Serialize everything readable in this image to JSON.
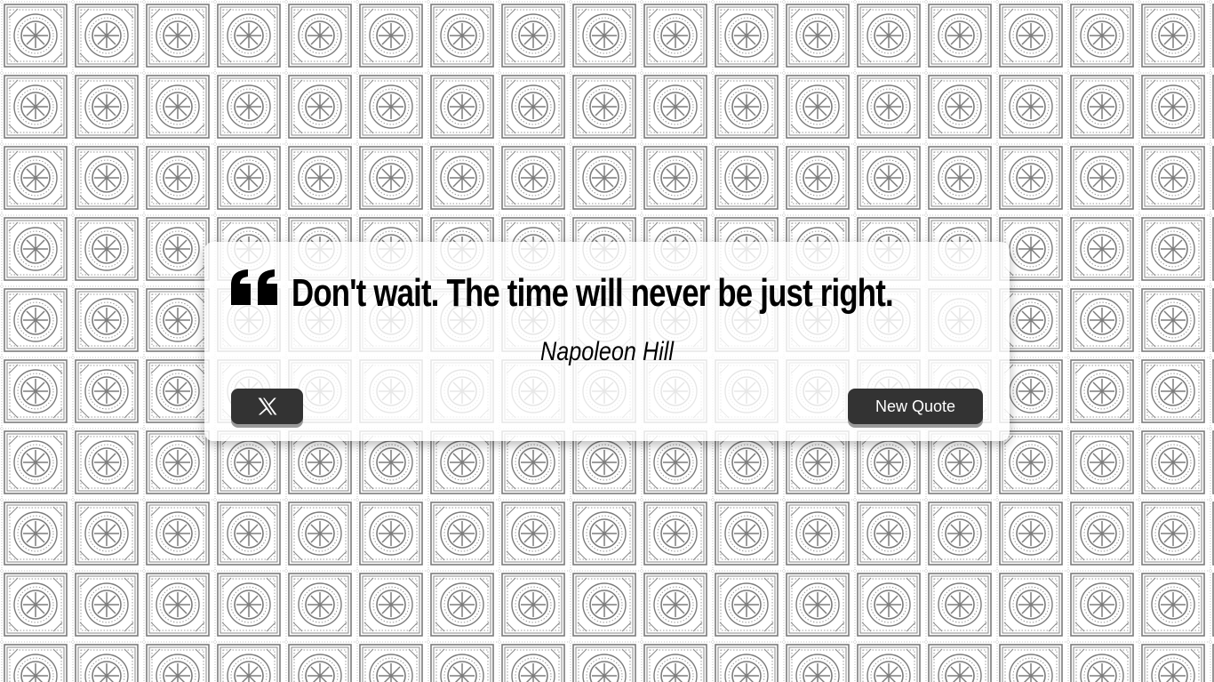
{
  "quote": {
    "text": "Don't wait. The time will never be just right.",
    "author": "Napoleon Hill",
    "quote_icon": "quote-left-icon"
  },
  "actions": {
    "share_icon": "x-logo-icon",
    "new_quote_label": "New Quote"
  },
  "colors": {
    "page_background": "#ffffff",
    "pattern_stroke": "#7a7a7a",
    "card_background": "#ffffff",
    "button_background": "#333333",
    "button_text": "#ffffff",
    "quote_text": "#000000"
  }
}
